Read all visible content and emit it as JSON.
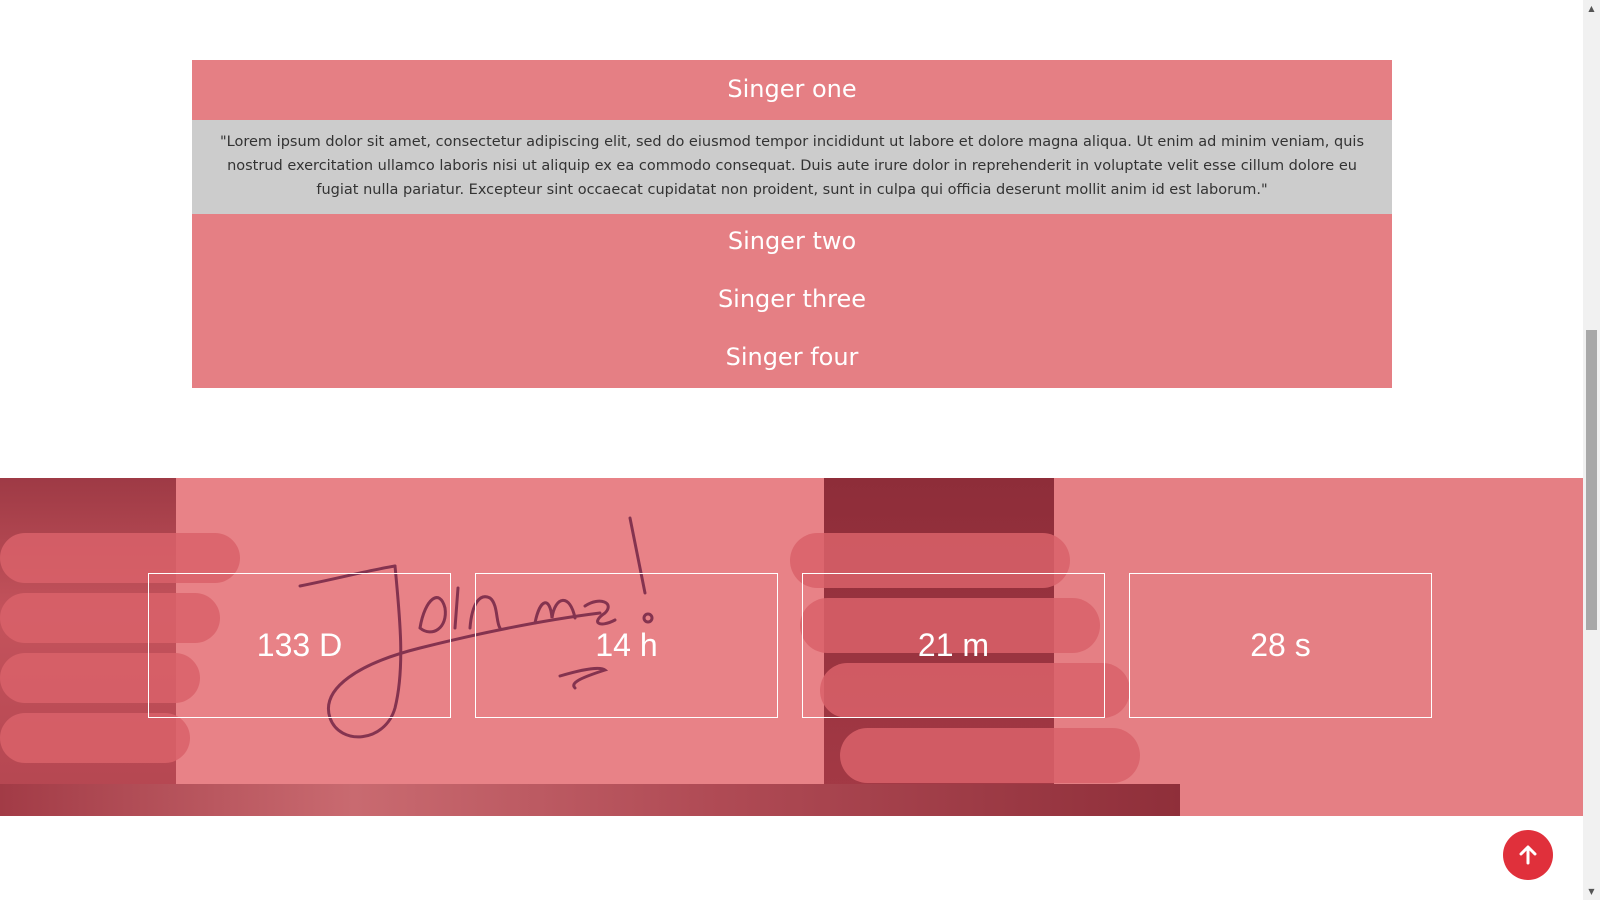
{
  "accordion": {
    "items": [
      {
        "title": "Singer one",
        "expanded": true,
        "body": "\"Lorem ipsum dolor sit amet, consectetur adipiscing elit, sed do eiusmod tempor incididunt ut labore et dolore magna aliqua. Ut enim ad minim veniam, quis nostrud exercitation ullamco laboris nisi ut aliquip ex ea commodo consequat. Duis aute irure dolor in reprehenderit in voluptate velit esse cillum dolore eu fugiat nulla pariatur. Excepteur sint occaecat cupidatat non proident, sunt in culpa qui officia deserunt mollit anim id est laborum.\""
      },
      {
        "title": "Singer two",
        "expanded": false
      },
      {
        "title": "Singer three",
        "expanded": false
      },
      {
        "title": "Singer four",
        "expanded": false
      }
    ]
  },
  "countdown": {
    "background_text": "Join us!",
    "days": "133 D",
    "hours": "14 h",
    "minutes": "21 m",
    "seconds": "28 s"
  },
  "scroll_top": {
    "icon": "arrow-up-icon"
  },
  "colors": {
    "accent": "#e57f84",
    "panel": "#cccccc",
    "button": "#e0303b"
  }
}
